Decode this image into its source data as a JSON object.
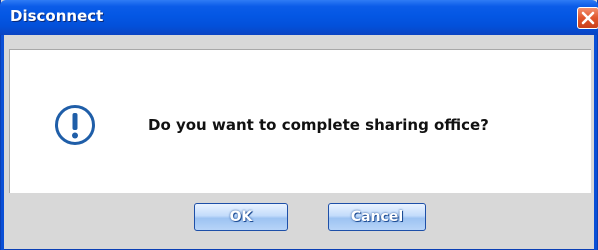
{
  "window": {
    "title": "Disconnect",
    "close_icon": "close-icon"
  },
  "message": {
    "icon": "exclamation-icon",
    "text": "Do you want to complete sharing office?"
  },
  "buttons": {
    "ok_label": "OK",
    "cancel_label": "Cancel"
  },
  "colors": {
    "titlebar": "#0457e4",
    "close_button": "#e0552c",
    "icon": "#1f5ea8",
    "button_border": "#1d4fa8",
    "footer_background": "#d8d8d8"
  }
}
